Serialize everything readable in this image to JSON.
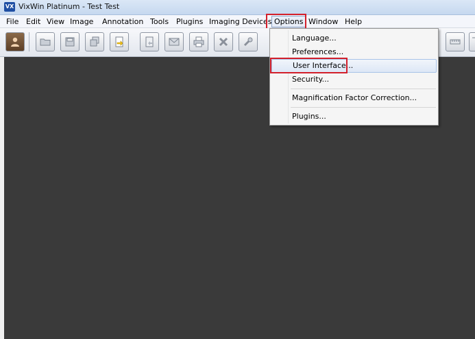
{
  "window": {
    "title": "VixWin Platinum - Test Test",
    "logo_text": "VX"
  },
  "menubar": {
    "items": [
      "File",
      "Edit",
      "View",
      "Image",
      "Annotation",
      "Tools",
      "Plugins",
      "Imaging Devices",
      "Options",
      "Window",
      "Help"
    ],
    "active": "Options"
  },
  "toolbar": {
    "buttons": [
      {
        "icon": "patient-icon"
      },
      {
        "icon": "open-folder-icon"
      },
      {
        "icon": "save-icon"
      },
      {
        "icon": "copy-images-icon"
      },
      {
        "icon": "import-icon"
      },
      {
        "icon": "export-icon"
      },
      {
        "icon": "email-icon"
      },
      {
        "icon": "print-icon"
      },
      {
        "icon": "delete-icon"
      },
      {
        "icon": "tool-icon"
      },
      {
        "icon": "ruler-icon"
      },
      {
        "icon": "text-icon"
      }
    ]
  },
  "options_menu": {
    "items": [
      {
        "label": "Language...",
        "highlighted": false
      },
      {
        "label": "Preferences...",
        "highlighted": false
      },
      {
        "label": "User Interface...",
        "highlighted": true
      },
      {
        "label": "Security...",
        "highlighted": false
      },
      {
        "label": "Magnification Factor Correction...",
        "highlighted": false
      },
      {
        "label": "Plugins...",
        "highlighted": false
      }
    ]
  },
  "colors": {
    "workarea": "#3a3a3a",
    "highlight_box": "#d31f2a"
  }
}
